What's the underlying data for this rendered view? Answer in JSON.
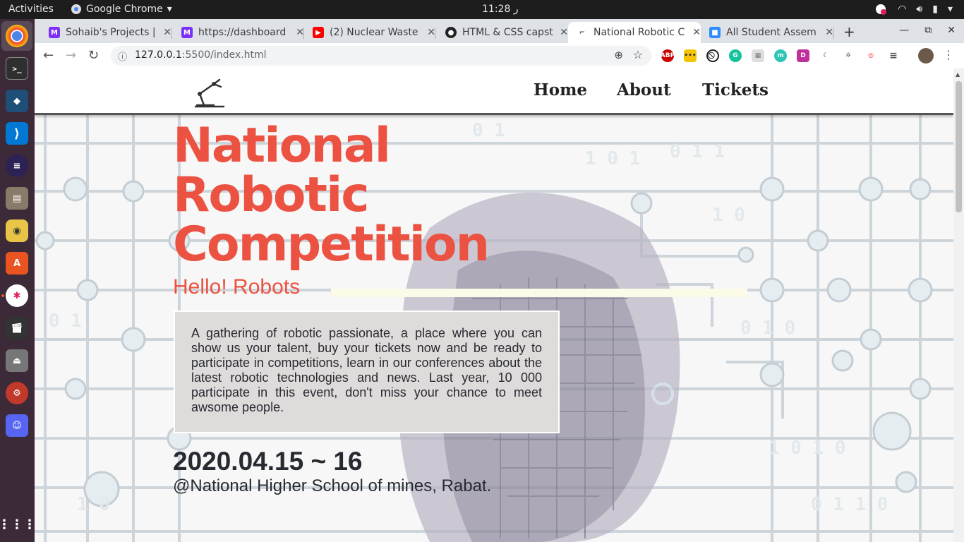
{
  "topbar": {
    "activities": "Activities",
    "app_name": "Google Chrome",
    "app_menu_icon": "chevron-down-icon",
    "clock": "11:28 ر"
  },
  "dock": {
    "items": [
      "chrome",
      "terminal",
      "mysql-workbench",
      "vscode",
      "eclipse",
      "files",
      "rhythmbox",
      "software-center",
      "slack",
      "clapper",
      "usb-creator",
      "settings",
      "discord"
    ],
    "apps_grid": "show-applications-icon"
  },
  "browser": {
    "tabs": [
      {
        "title": "Sohaib's Projects | ",
        "favicon": "purple-square-icon",
        "color": "#7b2ff7"
      },
      {
        "title": "https://dashboard",
        "favicon": "purple-square-icon",
        "color": "#7b2ff7"
      },
      {
        "title": "(2) Nuclear Waste",
        "favicon": "youtube-icon",
        "color": "#ff0000"
      },
      {
        "title": "HTML & CSS capst",
        "favicon": "github-icon",
        "color": "#222222"
      },
      {
        "title": "National Robotic C",
        "favicon": "robot-arm-icon",
        "color": "#555555"
      },
      {
        "title": "All Student Assem",
        "favicon": "zoom-icon",
        "color": "#2d8cff"
      }
    ],
    "url_host": "127.0.0.1",
    "url_rest": ":5500/index.html"
  },
  "site": {
    "nav": {
      "home": "Home",
      "about": "About",
      "tickets": "Tickets"
    },
    "title_lines": [
      "National",
      "Robotic",
      "Competition"
    ],
    "subtitle": "Hello! Robots",
    "description": "A gathering of robotic passionate, a place where you can show us your talent, buy your tickets now and be ready to participate in competitions, learn in our conferences about the latest robotic technologies and news. Last year, 10 000 participate in this event, don't miss your chance to meet awsome people.",
    "date": "2020.04.15 ~ 16",
    "venue": "@National Higher School of mines, Rabat.",
    "accent_color": "#ec5242"
  }
}
